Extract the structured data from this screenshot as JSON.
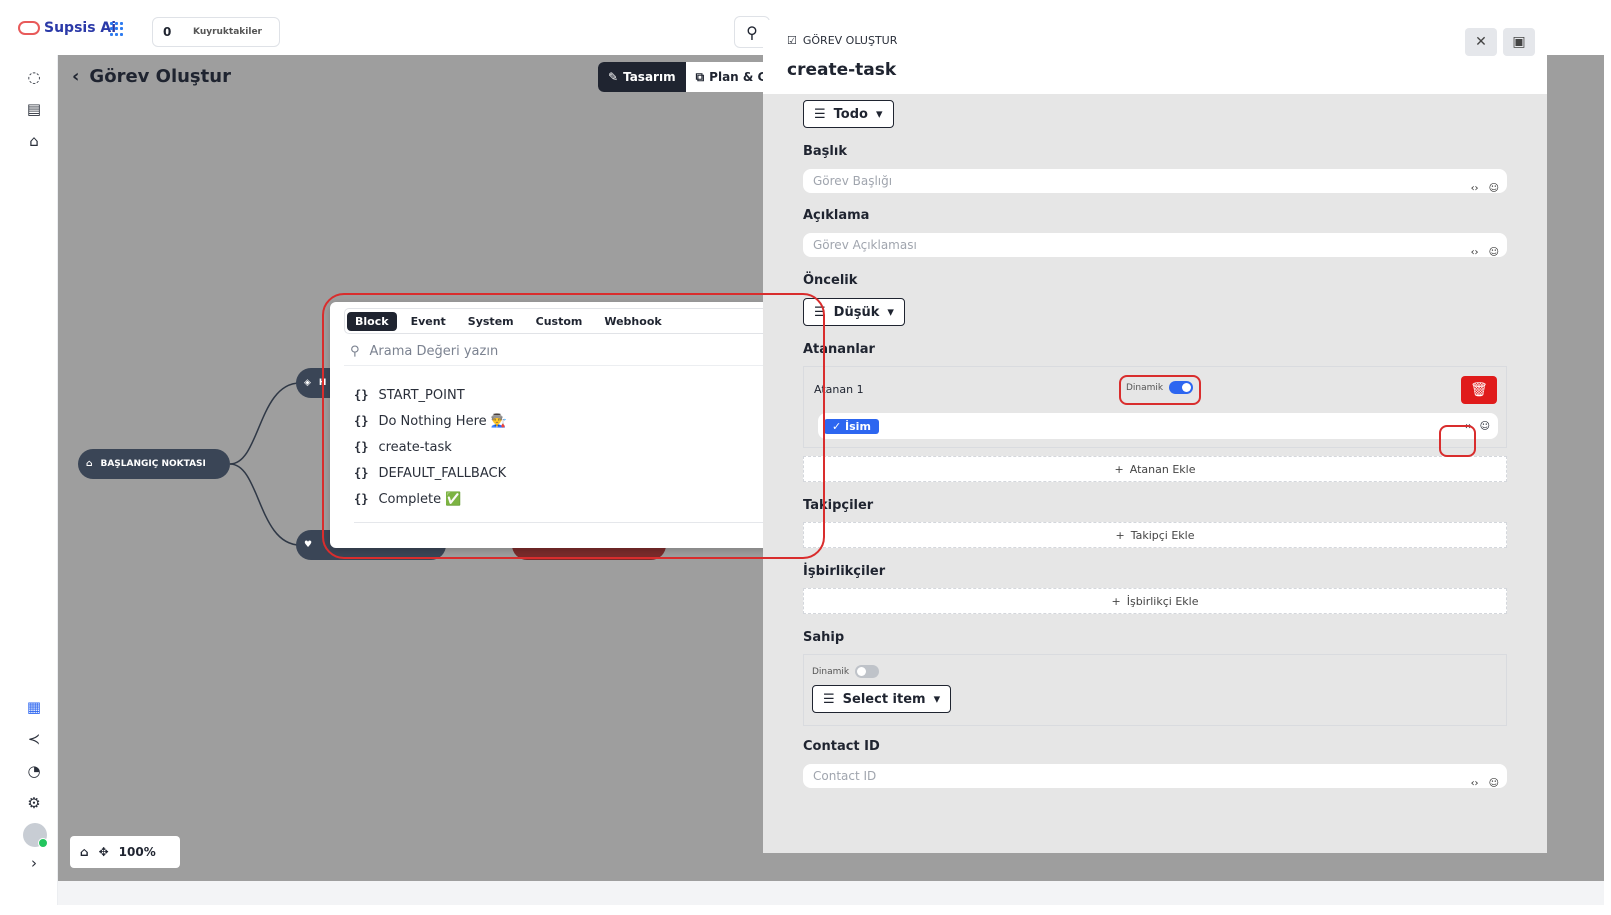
{
  "app": {
    "name": "Supsis Ai",
    "queue_count": "0",
    "queue_label": "Kuyruktakiler"
  },
  "page": {
    "title": "Görev Oluştur",
    "zoom": "100%"
  },
  "view_toggle": {
    "design": "Tasarım",
    "plan": "Plan & G"
  },
  "nodes": {
    "start": "BAŞLANGIÇ NOKTASI",
    "upper": "H",
    "lower": ""
  },
  "popup": {
    "tabs": [
      "Block",
      "Event",
      "System",
      "Custom",
      "Webhook"
    ],
    "search_placeholder": "Arama Değeri yazın",
    "items": [
      "START_POINT",
      "Do Nothing Here 👨‍🏭",
      "create-task",
      "DEFAULT_FALLBACK",
      "Complete ✅"
    ],
    "brace": "{}"
  },
  "panel": {
    "subtitle": "GÖREV OLUŞTUR",
    "title": "create-task",
    "status": "Todo",
    "title_label": "Başlık",
    "title_placeholder": "Görev Başlığı",
    "desc_label": "Açıklama",
    "desc_placeholder": "Görev Açıklaması",
    "priority_label": "Öncelik",
    "priority_value": "Düşük",
    "assignees_label": "Atananlar",
    "assignee_1": "Atanan 1",
    "dynamic_label": "Dinamik",
    "assignee_chip": "İsim",
    "add_assignee": "Atanan Ekle",
    "followers_label": "Takipçiler",
    "add_follower": "Takipçi Ekle",
    "collab_label": "İşbirlikçiler",
    "add_collab": "İşbirlikçi Ekle",
    "owner_label": "Sahip",
    "owner_select": "Select item",
    "contact_label": "Contact ID",
    "contact_placeholder": "Contact ID",
    "var_icon": "‹›",
    "emoji_icon": "☺"
  },
  "colors": {
    "accent": "#2d66f0",
    "danger": "#e01b1b",
    "highlight": "#d92d2d",
    "dark": "#1f2430"
  }
}
